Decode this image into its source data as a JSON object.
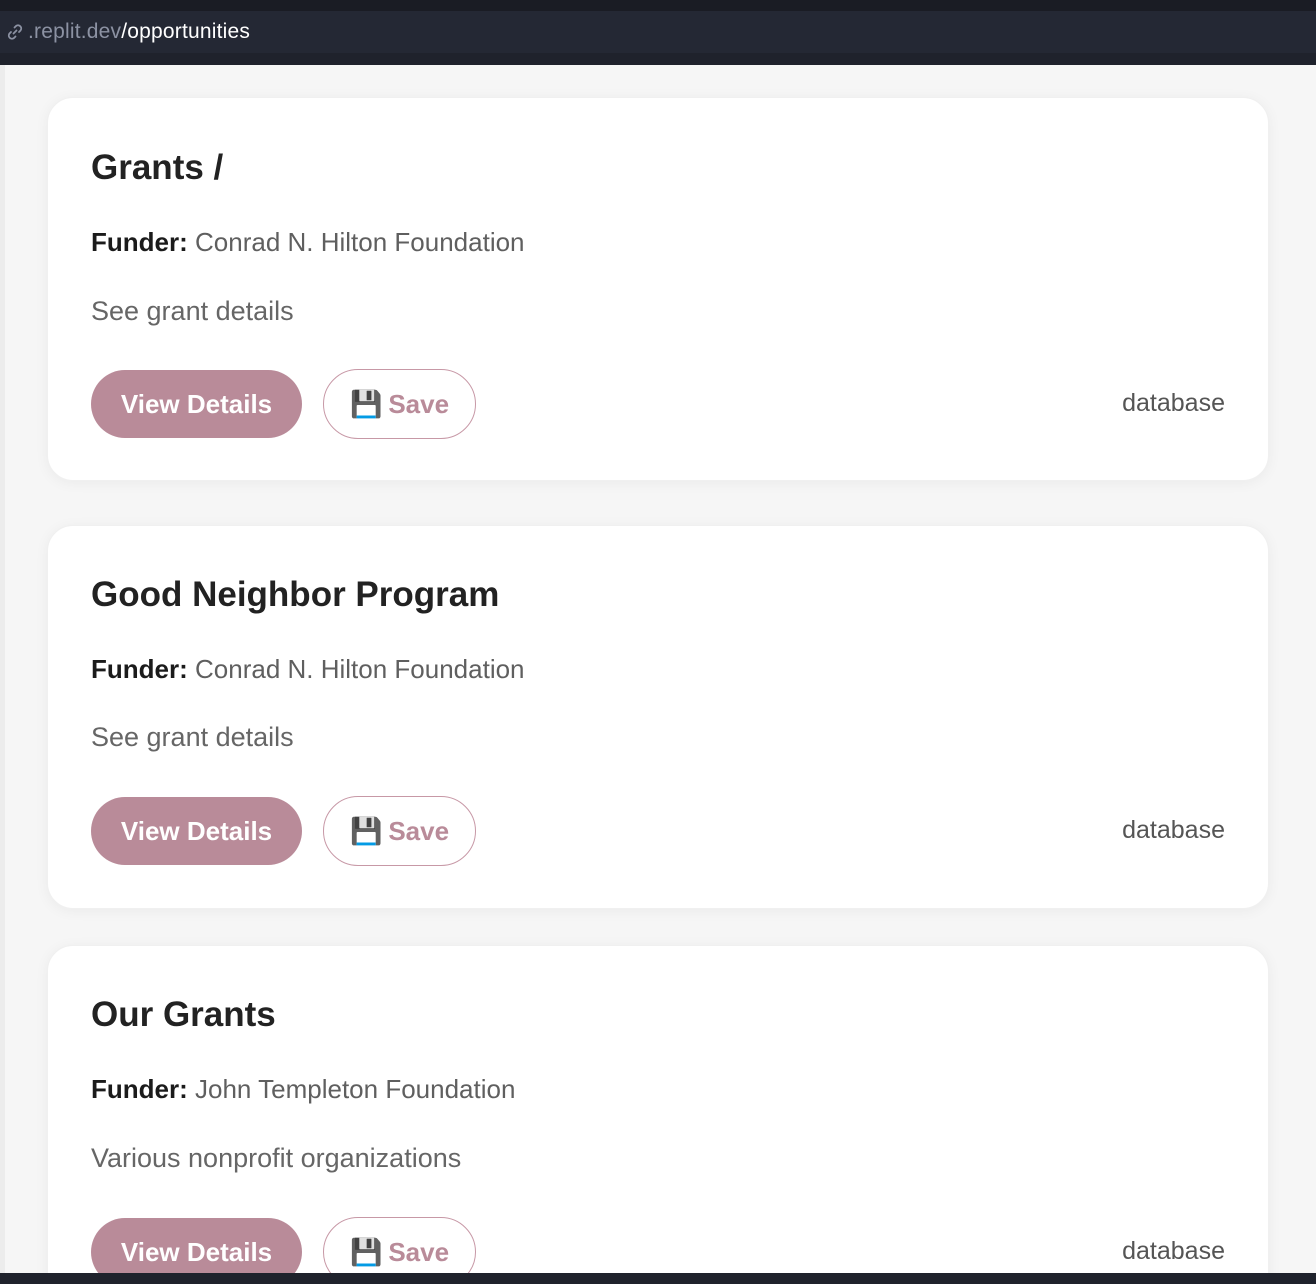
{
  "browser": {
    "url_host": ".replit.dev",
    "url_path": "/opportunities"
  },
  "buttons": {
    "view_label": "View Details",
    "save_label": "Save",
    "save_icon": "💾"
  },
  "opportunities": [
    {
      "title": "Grants /",
      "funder_label": "Funder:",
      "funder": "Conrad N. Hilton Foundation",
      "description": "See grant details",
      "source": "database"
    },
    {
      "title": "Good Neighbor Program",
      "funder_label": "Funder:",
      "funder": "Conrad N. Hilton Foundation",
      "description": "See grant details",
      "source": "database"
    },
    {
      "title": "Our Grants",
      "funder_label": "Funder:",
      "funder": "John Templeton Foundation",
      "description": "Various nonprofit organizations",
      "source": "database"
    }
  ]
}
